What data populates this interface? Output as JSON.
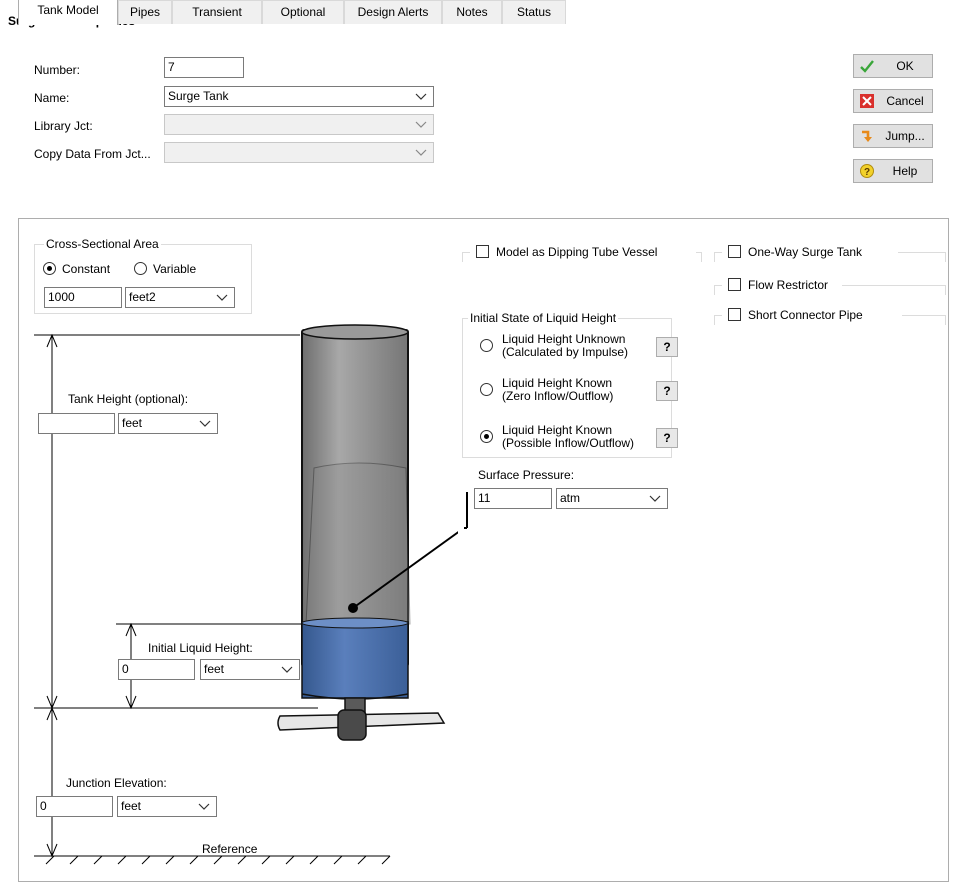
{
  "window": {
    "title": "Surge Tank Properties"
  },
  "header": {
    "number_label": "Number:",
    "number_value": "7",
    "name_label": "Name:",
    "name_value": "Surge Tank",
    "library_label": "Library Jct:",
    "library_value": "",
    "copy_label": "Copy Data From Jct...",
    "copy_value": ""
  },
  "buttons": {
    "ok": "OK",
    "cancel": "Cancel",
    "jump": "Jump...",
    "help": "Help"
  },
  "tabs": [
    "Tank Model",
    "Pipes",
    "Transient",
    "Optional",
    "Design Alerts",
    "Notes",
    "Status"
  ],
  "area": {
    "group_label": "Cross-Sectional Area",
    "constant": "Constant",
    "variable": "Variable",
    "value": "1000",
    "unit": "feet2"
  },
  "tank_height": {
    "label": "Tank Height (optional):",
    "value": "",
    "unit": "feet"
  },
  "initial_liquid": {
    "label": "Initial Liquid Height:",
    "value": "0",
    "unit": "feet"
  },
  "junction_elev": {
    "label": "Junction Elevation:",
    "value": "0",
    "unit": "feet"
  },
  "reference_label": "Reference",
  "options": {
    "dipping": "Model as Dipping Tube Vessel",
    "one_way": "One-Way Surge Tank",
    "flow_restrictor": "Flow Restrictor",
    "short_connector": "Short Connector Pipe"
  },
  "initial_state": {
    "group_label": "Initial State of Liquid Height",
    "opt1_line1": "Liquid Height Unknown",
    "opt1_line2": "(Calculated by Impulse)",
    "opt2_line1": "Liquid Height Known",
    "opt2_line2": "(Zero Inflow/Outflow)",
    "opt3_line1": "Liquid Height Known",
    "opt3_line2": "(Possible Inflow/Outflow)",
    "help": "?"
  },
  "surface_pressure": {
    "label": "Surface Pressure:",
    "value": "11",
    "unit": "atm"
  },
  "colors": {
    "liquid": "#4a6fa8",
    "tank": "#8e8e8e",
    "ok_icon": "#3aa63a",
    "cancel_icon": "#d9302c"
  }
}
